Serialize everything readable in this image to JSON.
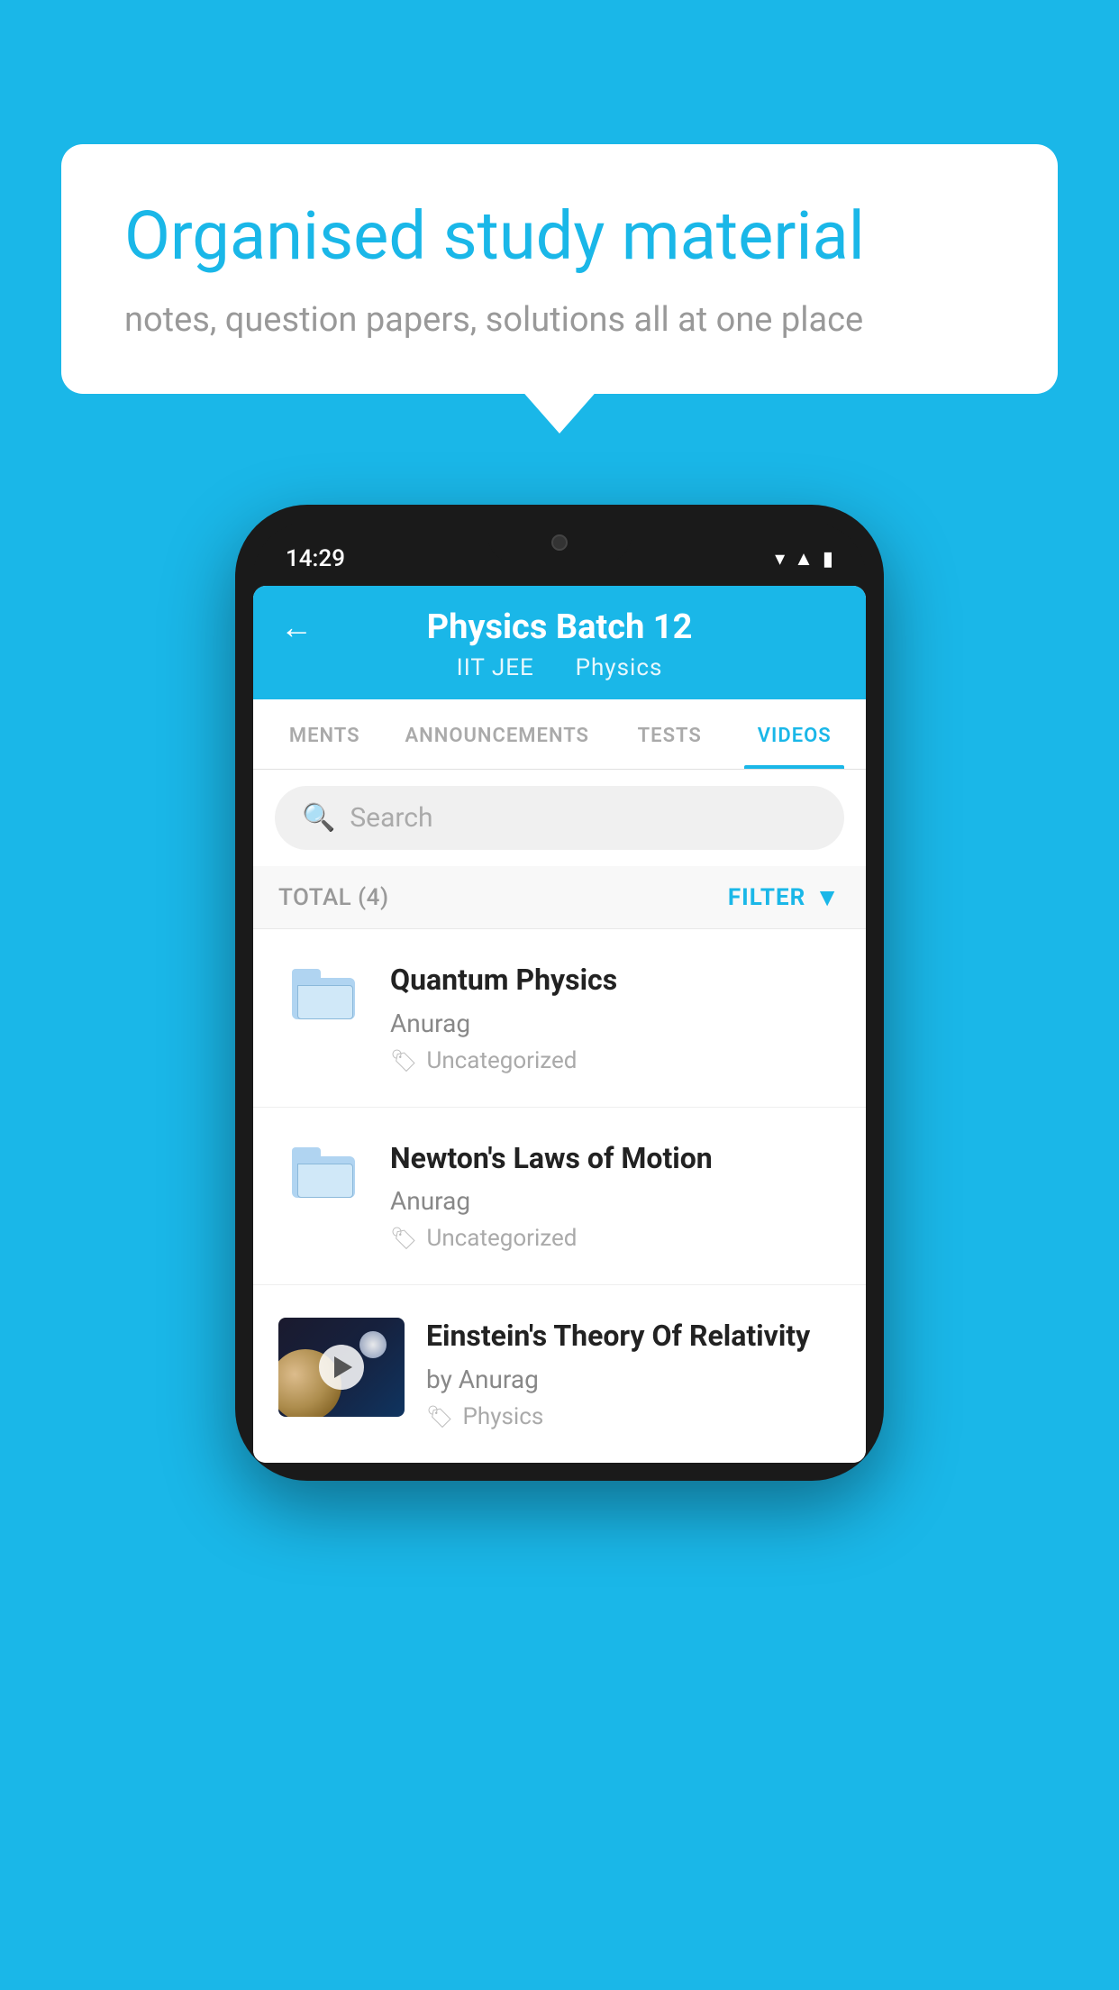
{
  "background": {
    "color": "#1ab7e8"
  },
  "speech_bubble": {
    "headline": "Organised study material",
    "subtitle": "notes, question papers, solutions all at one place"
  },
  "phone": {
    "status_bar": {
      "time": "14:29",
      "icons": [
        "wifi",
        "signal",
        "battery"
      ]
    },
    "header": {
      "back_label": "←",
      "title": "Physics Batch 12",
      "subtitle_part1": "IIT JEE",
      "subtitle_part2": "Physics"
    },
    "tabs": [
      {
        "label": "MENTS",
        "active": false
      },
      {
        "label": "ANNOUNCEMENTS",
        "active": false
      },
      {
        "label": "TESTS",
        "active": false
      },
      {
        "label": "VIDEOS",
        "active": true
      }
    ],
    "search": {
      "placeholder": "Search"
    },
    "filter_bar": {
      "total_label": "TOTAL (4)",
      "filter_label": "FILTER"
    },
    "video_items": [
      {
        "id": 1,
        "title": "Quantum Physics",
        "author": "Anurag",
        "tag": "Uncategorized",
        "type": "folder",
        "has_thumbnail": false
      },
      {
        "id": 2,
        "title": "Newton's Laws of Motion",
        "author": "Anurag",
        "tag": "Uncategorized",
        "type": "folder",
        "has_thumbnail": false
      },
      {
        "id": 3,
        "title": "Einstein's Theory Of Relativity",
        "author": "by Anurag",
        "tag": "Physics",
        "type": "video",
        "has_thumbnail": true
      }
    ]
  }
}
